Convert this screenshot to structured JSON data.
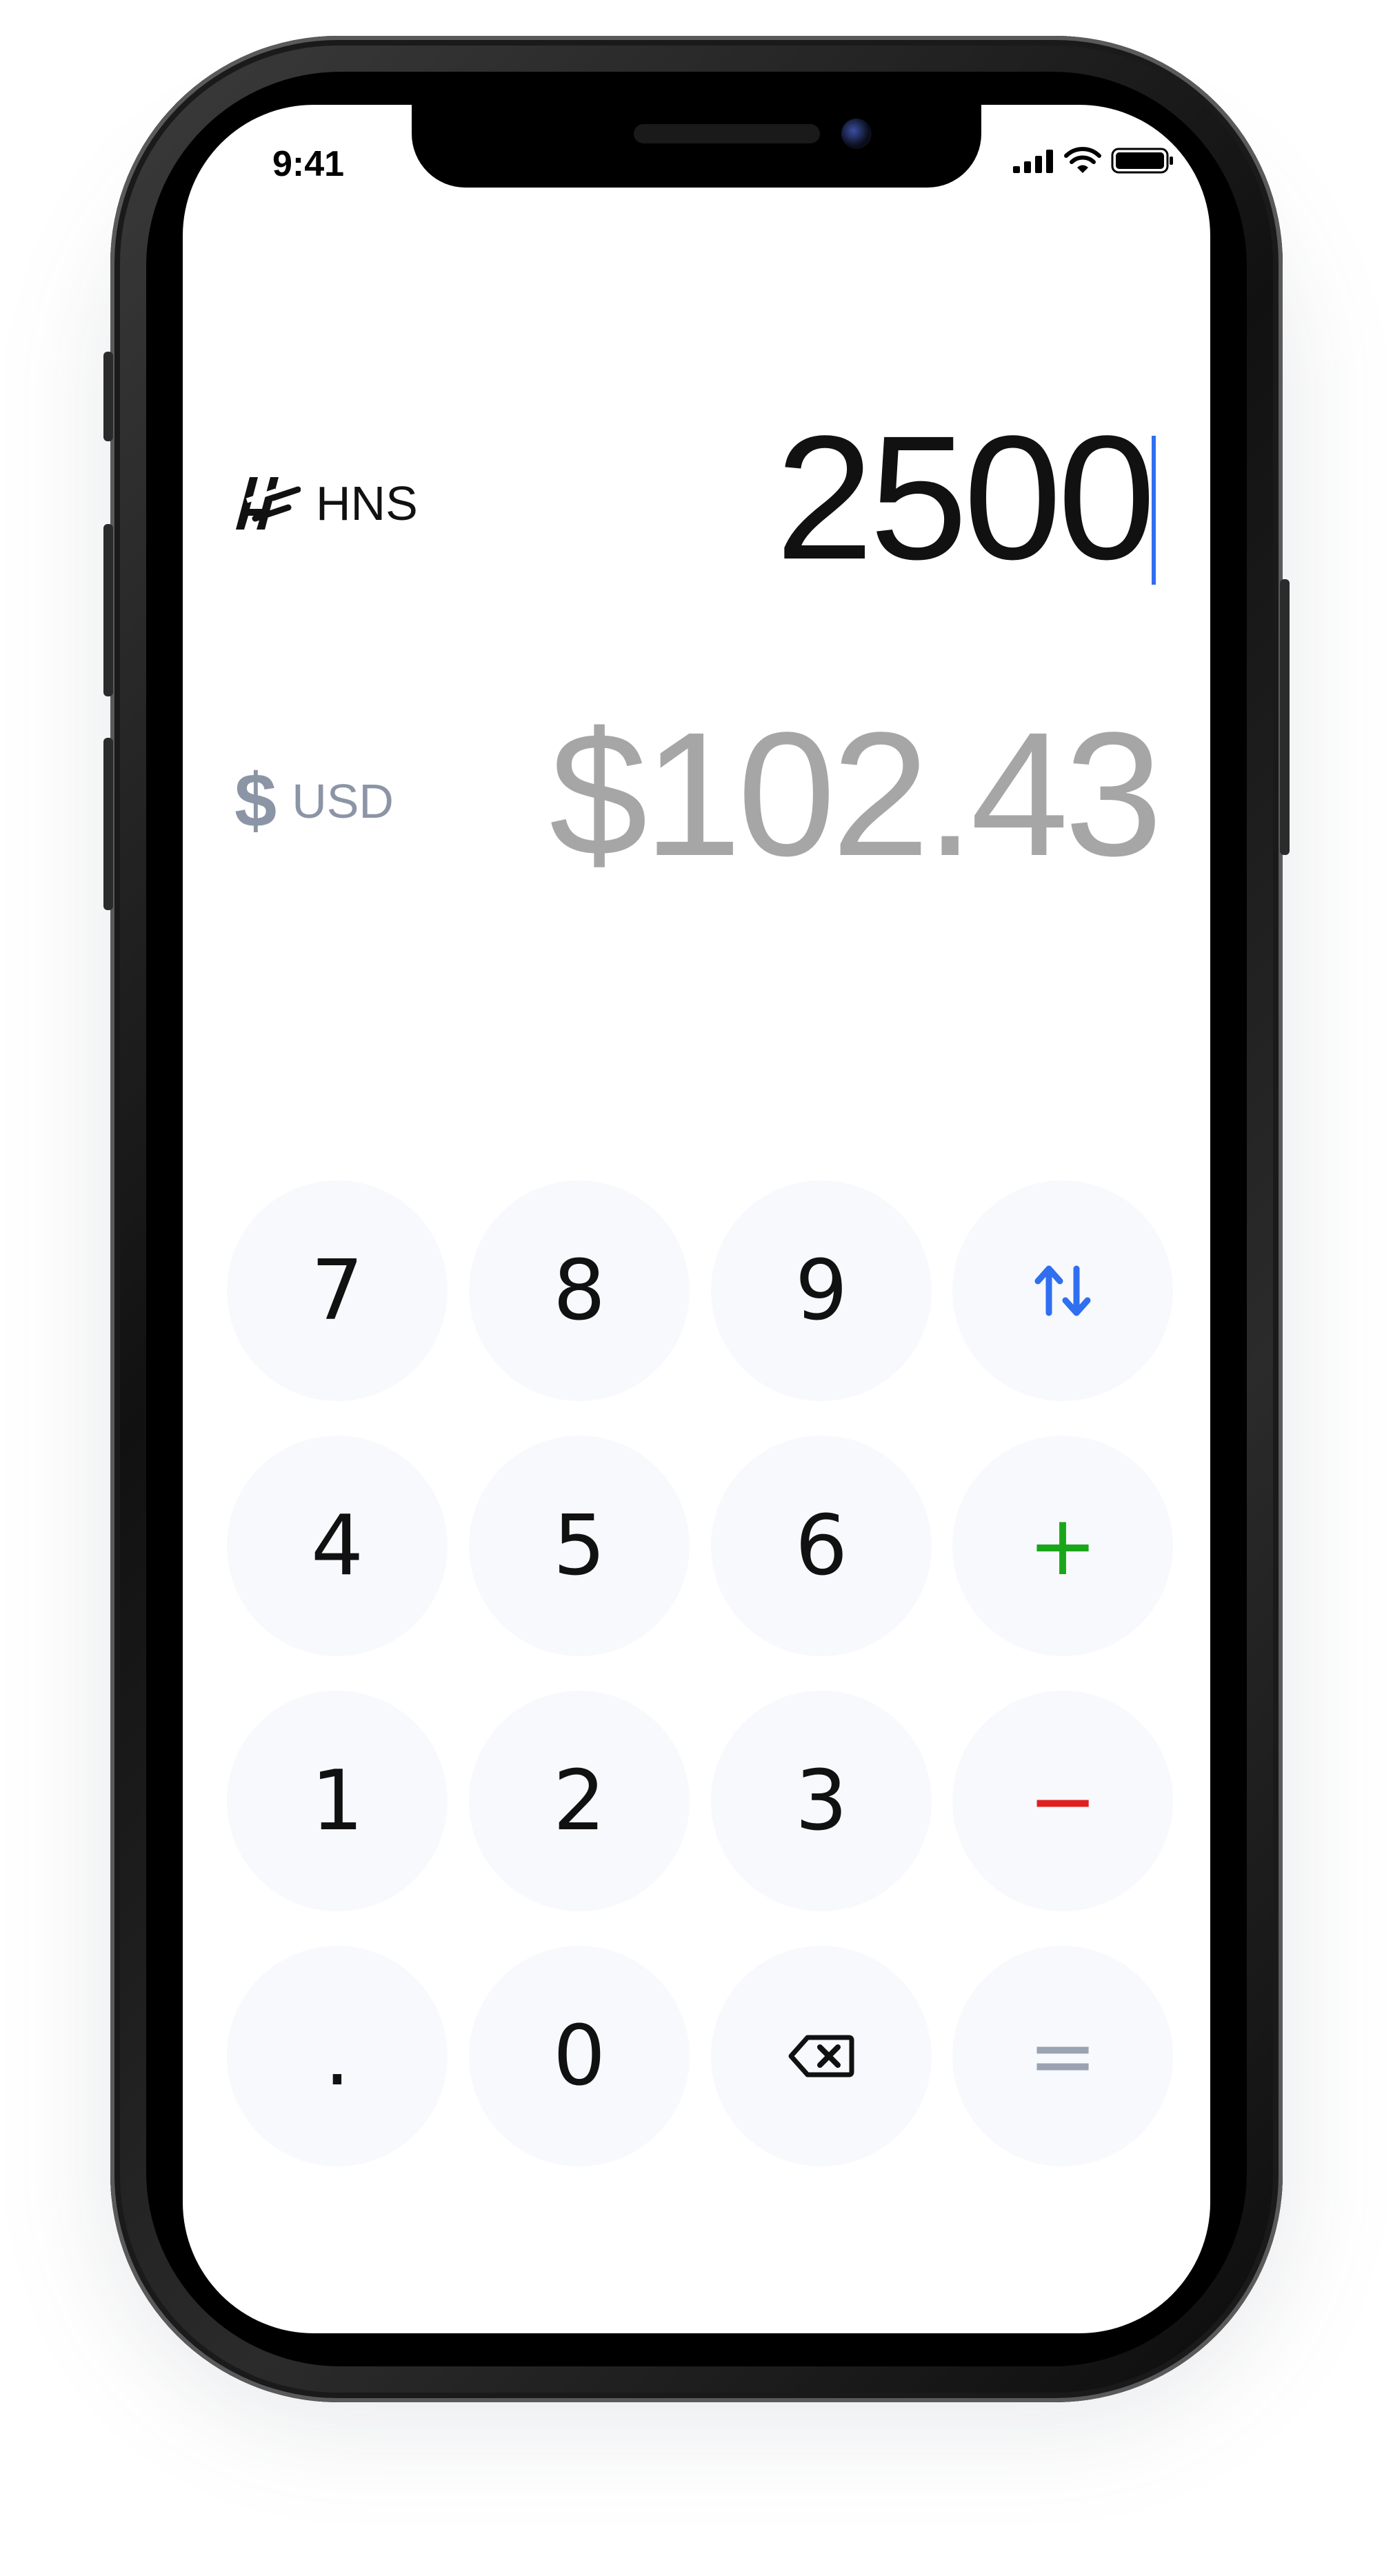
{
  "status_bar": {
    "time": "9:41"
  },
  "converter": {
    "from": {
      "code": "HNS",
      "amount": "2500",
      "icon": "handshake-logo-icon"
    },
    "to": {
      "code": "USD",
      "amount": "$102.43",
      "icon_glyph": "$"
    }
  },
  "keypad": {
    "k7": "7",
    "k8": "8",
    "k9": "9",
    "k4": "4",
    "k5": "5",
    "k6": "6",
    "k1": "1",
    "k2": "2",
    "k3": "3",
    "kdot": ".",
    "k0": "0",
    "plus": "+",
    "minus": "−",
    "equals": "="
  },
  "colors": {
    "caret": "#2f6ff0",
    "swap": "#2f6ff0",
    "plus": "#1aa61a",
    "minus": "#e02020",
    "equals": "#9aa3b2",
    "key_bg": "#f7f9fd",
    "secondary_text": "#a6a6a6"
  }
}
